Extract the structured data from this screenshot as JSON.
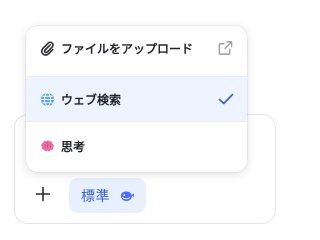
{
  "menu": {
    "items": [
      {
        "label": "ファイルをアップロード",
        "icon": "paperclip-icon",
        "trailing_icon": "external-link-icon",
        "selected": false
      },
      {
        "label": "ウェブ検索",
        "icon": "globe-icon",
        "trailing_icon": "checkmark-icon",
        "selected": true
      },
      {
        "label": "思考",
        "icon": "brain-icon",
        "trailing_icon": "",
        "selected": false
      }
    ]
  },
  "composer": {
    "plus_icon": "plus-icon",
    "mode_chip_label": "標準",
    "mode_chip_icon": "whale-icon"
  },
  "colors": {
    "selected_bg": "#eef4ff",
    "accent": "#3b63c4",
    "chip_bg": "#e8f0fd"
  }
}
